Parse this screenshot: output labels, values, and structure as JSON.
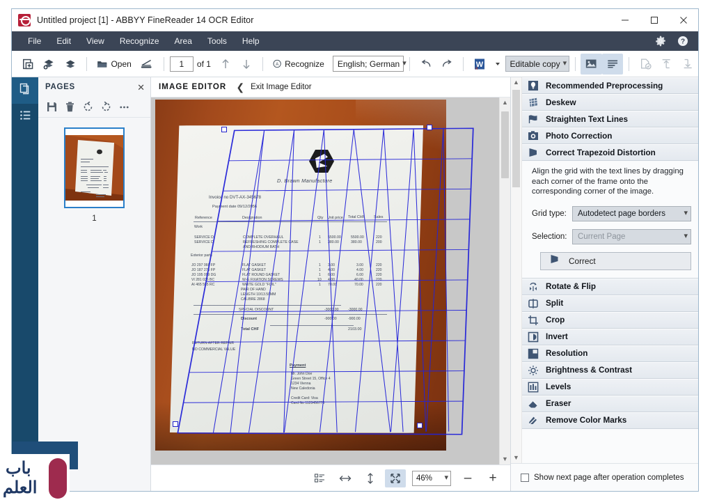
{
  "window": {
    "title": "Untitled project [1] - ABBYY FineReader 14 OCR Editor",
    "minimize": "–",
    "maximize": "□",
    "close": "✕"
  },
  "menubar": {
    "items": [
      {
        "label": "File"
      },
      {
        "label": "Edit"
      },
      {
        "label": "View"
      },
      {
        "label": "Recognize"
      },
      {
        "label": "Area"
      },
      {
        "label": "Tools"
      },
      {
        "label": "Help"
      }
    ],
    "right_icons": [
      "gear-icon",
      "help-icon"
    ]
  },
  "toolbar": {
    "new_task_icon": "new-document-icon",
    "add_pages_icon": "add-pages-icon",
    "pages_icon": "pages-stack-icon",
    "open_label": "Open",
    "scan_icon": "scanner-icon",
    "page_number": "1",
    "page_of": "of 1",
    "prev_page_icon": "arrow-up-icon",
    "next_page_icon": "arrow-down-icon",
    "recognize_label": "Recognize",
    "language_value": "English; German",
    "undo_icon": "undo-icon",
    "redo_icon": "redo-icon",
    "export_format_icon": "word-icon",
    "export_mode_value": "Editable copy",
    "view_image_icon": "image-view-icon",
    "view_text_icon": "text-view-icon",
    "verify_icon": "verify-document-icon",
    "send_up_icon": "send-to-icon",
    "send_down_icon": "receive-from-icon"
  },
  "rail": {
    "pages_icon": "pages-panel-icon",
    "list_icon": "list-panel-icon"
  },
  "pages_panel": {
    "title": "PAGES",
    "close_icon": "close-icon",
    "tools": [
      {
        "name": "save-icon"
      },
      {
        "name": "delete-icon"
      },
      {
        "name": "rotate-left-icon"
      },
      {
        "name": "rotate-right-icon"
      },
      {
        "name": "more-options-icon"
      }
    ],
    "thumbnails": [
      {
        "number": "1",
        "selected": true
      }
    ]
  },
  "image_editor": {
    "title": "IMAGE EDITOR",
    "back_icon": "chevron-left-icon",
    "exit_label": "Exit Image Editor"
  },
  "document": {
    "company": "D. Brawn Manufacture",
    "invoice_no": "Invoice no  DVT-AX-345678",
    "payment_date": "Payment date  09/12/2056",
    "table_headers": [
      "Reference",
      "Designation",
      "Qty",
      "Unit price",
      "Total CHF",
      "Sales"
    ],
    "section_work": "Work",
    "work_rows": [
      {
        "reference": "SERVICE D",
        "designation": "COMPLETE OVERHAUL",
        "qty": "1",
        "unit": "5500.00",
        "total": "5500.00",
        "sales": "220"
      },
      {
        "reference": "SERVICE D",
        "designation": "REFRESHING COMPLETE CASE",
        "qty": "1",
        "unit": "380.00",
        "total": "380.00",
        "sales": "200"
      },
      {
        "reference": "",
        "designation": "AND RHODIUM BATH",
        "qty": "",
        "unit": "",
        "total": "",
        "sales": ""
      }
    ],
    "section_parts": "Exterior parts",
    "parts_rows": [
      {
        "reference": "JO 297 066 FP",
        "designation": "FLAT GASKET",
        "qty": "1",
        "unit": "3.00",
        "total": "3.00",
        "sales": "220"
      },
      {
        "reference": "JO 187 275 FP",
        "designation": "FLAT GASKET",
        "qty": "1",
        "unit": "4.00",
        "total": "4.00",
        "sales": "220"
      },
      {
        "reference": "JO 195 099 DG",
        "designation": "FLAT ROUND GASKET",
        "qty": "1",
        "unit": "6.00",
        "total": "6.00",
        "sales": "220"
      },
      {
        "reference": "VI 281 036 BC",
        "designation": "W-G FIXATION SCREWS",
        "qty": "10",
        "unit": "4.00",
        "total": "40.00",
        "sales": "220"
      },
      {
        "reference": "AI 465 555 RC",
        "designation": "WHITE GOLD \"FOIL\"",
        "qty": "1",
        "unit": "70.00",
        "total": "70.00",
        "sales": "220"
      },
      {
        "reference": "",
        "designation": "PAIR OF HAND",
        "qty": "",
        "unit": "",
        "total": "",
        "sales": ""
      },
      {
        "reference": "",
        "designation": "LENGTH  10/13.50MM",
        "qty": "",
        "unit": "",
        "total": "",
        "sales": ""
      },
      {
        "reference": "",
        "designation": "CALIBRE 2868",
        "qty": "",
        "unit": "",
        "total": "",
        "sales": ""
      }
    ],
    "totals": [
      {
        "label": "SPECIAL DISCOUNT",
        "unit": "-3000.00",
        "total": "-3000.00"
      },
      {
        "label": "Discount",
        "unit": "-900.00",
        "total": "-900.00"
      },
      {
        "label": "Total CHF",
        "unit": "",
        "total": "2103.00"
      }
    ],
    "notes": [
      "RETURN AFTER REPAIR",
      "NO COMMERCIAL VALUE"
    ],
    "payment_title": "Payment",
    "payment_lines": [
      "Mr.  John Doe",
      "Green Street 15, Office 4",
      "1234 Vienna",
      "New Caledonia",
      "",
      "Credit Card: Visa",
      "Card No  1123456778"
    ]
  },
  "zoombar": {
    "fit_page_icon": "fit-page-icon",
    "fit_width_icon": "fit-width-icon",
    "fit_height_icon": "fit-height-icon",
    "best_fit_icon": "best-fit-icon",
    "zoom_value": "46%",
    "zoom_out": "–",
    "zoom_in": "+"
  },
  "right_panel": {
    "operations": [
      {
        "name": "recommended-preprocessing",
        "label": "Recommended Preprocessing",
        "accel": "R",
        "icon": "lightbulb-icon",
        "expanded": false
      },
      {
        "name": "deskew",
        "label": "Deskew",
        "accel": "k",
        "icon": "deskew-icon",
        "expanded": false
      },
      {
        "name": "straighten-text-lines",
        "label": "Straighten Text Lines",
        "accel": "x",
        "icon": "flag-icon",
        "expanded": false
      },
      {
        "name": "photo-correction",
        "label": "Photo Correction",
        "accel": "h",
        "icon": "camera-icon",
        "expanded": false
      },
      {
        "name": "correct-trapezoid-distortion",
        "label": "Correct Trapezoid Distortion",
        "accel": "z",
        "icon": "trapezoid-icon",
        "expanded": true
      },
      {
        "name": "rotate-flip",
        "label": "Rotate & Flip",
        "accel": "o",
        "icon": "rotate-flip-icon",
        "expanded": false
      },
      {
        "name": "split",
        "label": "Split",
        "accel": "i",
        "icon": "split-icon",
        "expanded": false
      },
      {
        "name": "crop",
        "label": "Crop",
        "accel": "C",
        "icon": "crop-icon",
        "expanded": false
      },
      {
        "name": "invert",
        "label": "Invert",
        "accel": "v",
        "icon": "invert-icon",
        "expanded": false
      },
      {
        "name": "resolution",
        "label": "Resolution",
        "accel": "l",
        "icon": "resolution-icon",
        "expanded": false
      },
      {
        "name": "brightness-contrast",
        "label": "Brightness & Contrast",
        "accel": "t",
        "icon": "brightness-icon",
        "expanded": false
      },
      {
        "name": "levels",
        "label": "Levels",
        "accel": "L",
        "icon": "levels-icon",
        "expanded": false
      },
      {
        "name": "eraser",
        "label": "Eraser",
        "accel": "a",
        "icon": "eraser-icon",
        "expanded": false
      },
      {
        "name": "remove-color-marks",
        "label": "Remove Color Marks",
        "accel": "M",
        "icon": "remove-color-icon",
        "expanded": false
      }
    ],
    "trapezoid": {
      "hint": "Align the grid with the text lines by dragging each corner of the frame onto the corresponding corner of the image.",
      "grid_type_label": "Grid type:",
      "grid_type_value": "Autodetect page borders",
      "selection_label": "Selection:",
      "selection_value": "Current Page",
      "correct_button": "Correct",
      "correct_icon": "trapezoid-icon"
    },
    "footer": {
      "checkbox_label": "Show next page after operation completes",
      "checked": false
    }
  },
  "colors": {
    "menubar_bg": "#3b4556",
    "rail_bg": "#18496b",
    "accent_blue": "#2a7fc9",
    "grid_blue": "#2222dd",
    "canvas_bg": "#c8c8c8",
    "panel_bg": "#fafbfc",
    "op_row_bg": "#e8ecf1"
  },
  "watermark": {
    "alt": "bab-al-ilm-logo"
  }
}
